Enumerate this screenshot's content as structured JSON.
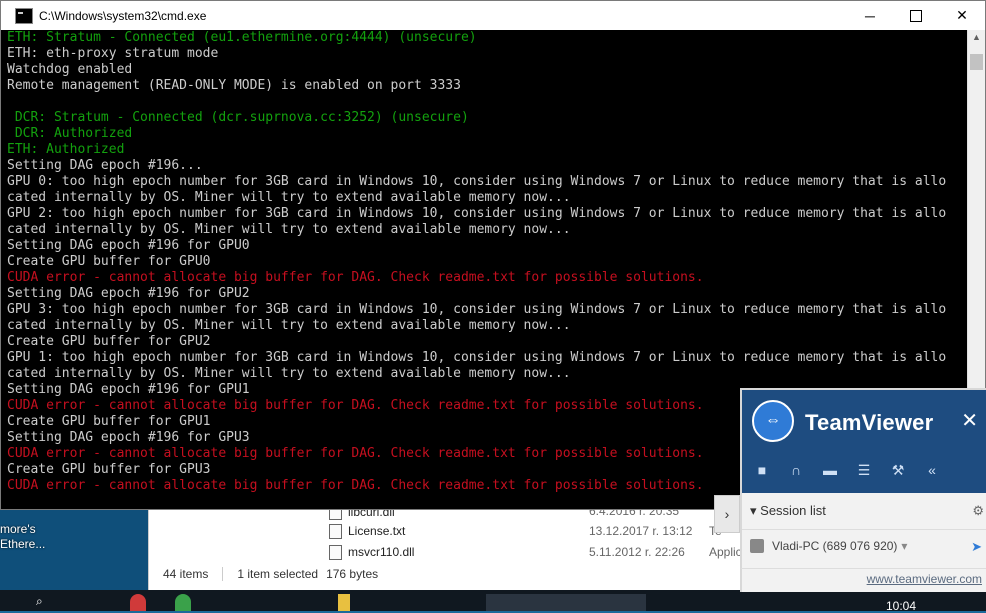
{
  "desktop": {
    "label_line1": "more's",
    "label_line2": "Ethere..."
  },
  "explorer": {
    "files": [
      {
        "name": "libcurl.dll",
        "date": "6.4.2016 r. 20:35",
        "type": ""
      },
      {
        "name": "License.txt",
        "date": "13.12.2017 r. 13:12",
        "type": "Te"
      },
      {
        "name": "msvcr110.dll",
        "date": "5.11.2012 r. 22:26",
        "type": "Applic"
      }
    ],
    "status": {
      "items": "44 items",
      "selected": "1 item selected",
      "size": "176 bytes"
    }
  },
  "taskbar": {
    "clock": "10:04"
  },
  "cmd": {
    "title": "C:\\Windows\\system32\\cmd.exe",
    "lines": [
      {
        "text": "ETH: Stratum - Connected (eu1.ethermine.org:4444) (unsecure)",
        "color": "green"
      },
      {
        "text": "ETH: eth-proxy stratum mode",
        "color": "gray"
      },
      {
        "text": "Watchdog enabled",
        "color": "gray"
      },
      {
        "text": "Remote management (READ-ONLY MODE) is enabled on port 3333",
        "color": "gray"
      },
      {
        "text": "",
        "color": "gray"
      },
      {
        "text": " DCR: Stratum - Connected (dcr.suprnova.cc:3252) (unsecure)",
        "color": "green"
      },
      {
        "text": " DCR: Authorized",
        "color": "green"
      },
      {
        "text": "ETH: Authorized",
        "color": "green"
      },
      {
        "text": "Setting DAG epoch #196...",
        "color": "gray"
      },
      {
        "text": "GPU 0: too high epoch number for 3GB card in Windows 10, consider using Windows 7 or Linux to reduce memory that is allo",
        "color": "gray"
      },
      {
        "text": "cated internally by OS. Miner will try to extend available memory now...",
        "color": "gray"
      },
      {
        "text": "GPU 2: too high epoch number for 3GB card in Windows 10, consider using Windows 7 or Linux to reduce memory that is allo",
        "color": "gray"
      },
      {
        "text": "cated internally by OS. Miner will try to extend available memory now...",
        "color": "gray"
      },
      {
        "text": "Setting DAG epoch #196 for GPU0",
        "color": "gray"
      },
      {
        "text": "Create GPU buffer for GPU0",
        "color": "gray"
      },
      {
        "text": "CUDA error - cannot allocate big buffer for DAG. Check readme.txt for possible solutions.",
        "color": "red"
      },
      {
        "text": "Setting DAG epoch #196 for GPU2",
        "color": "gray"
      },
      {
        "text": "GPU 3: too high epoch number for 3GB card in Windows 10, consider using Windows 7 or Linux to reduce memory that is allo",
        "color": "gray"
      },
      {
        "text": "cated internally by OS. Miner will try to extend available memory now...",
        "color": "gray"
      },
      {
        "text": "Create GPU buffer for GPU2",
        "color": "gray"
      },
      {
        "text": "GPU 1: too high epoch number for 3GB card in Windows 10, consider using Windows 7 or Linux to reduce memory that is allo",
        "color": "gray"
      },
      {
        "text": "cated internally by OS. Miner will try to extend available memory now...",
        "color": "gray"
      },
      {
        "text": "Setting DAG epoch #196 for GPU1",
        "color": "gray"
      },
      {
        "text": "CUDA error - cannot allocate big buffer for DAG. Check readme.txt for possible solutions.",
        "color": "red"
      },
      {
        "text": "Create GPU buffer for GPU1",
        "color": "gray"
      },
      {
        "text": "Setting DAG epoch #196 for GPU3",
        "color": "gray"
      },
      {
        "text": "CUDA error - cannot allocate big buffer for DAG. Check readme.txt for possible solutions.",
        "color": "red"
      },
      {
        "text": "Create GPU buffer for GPU3",
        "color": "gray"
      },
      {
        "text": "CUDA error - cannot allocate big buffer for DAG. Check readme.txt for possible solutions.",
        "color": "red"
      }
    ]
  },
  "teamviewer": {
    "name": "TeamViewer",
    "session_list_label": "Session list",
    "partner": "Vladi-PC (689 076 920)",
    "link": "www.teamviewer.com"
  },
  "colors": {
    "console_bg": "#000000",
    "console_text": "#c0c0c0",
    "green": "#13a10e",
    "red": "#c50f1f",
    "teamviewer_blue": "#1e4c80"
  },
  "icons": {
    "tv_tools": [
      "video-icon",
      "headset-icon",
      "chat-icon",
      "file-transfer-icon",
      "tools-icon",
      "collapse-left-icon"
    ]
  }
}
